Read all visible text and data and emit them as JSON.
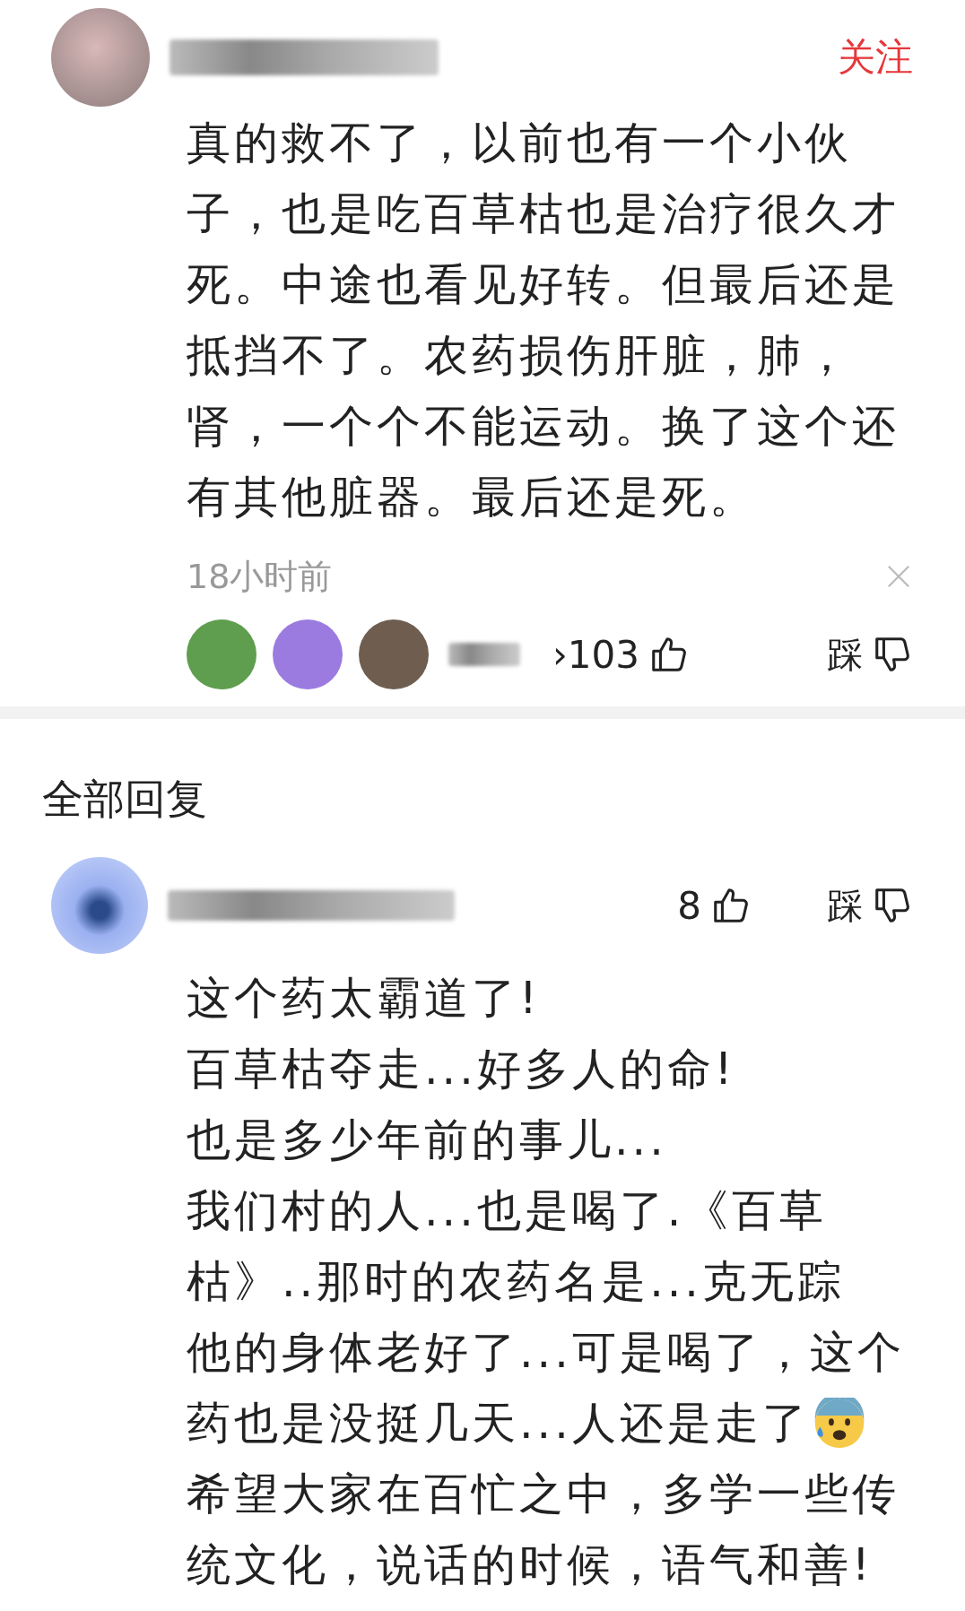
{
  "comment": {
    "follow": "关注",
    "text_lines": [
      {
        "text": "真的救不了，以前也有一个小伙"
      },
      {
        "text": "子，也是吃百草枯也是治疗很久才"
      },
      {
        "text": "死。中途也看见好转。但最后还是"
      },
      {
        "text": "抵挡不了。农药损伤肝脏，肺，"
      },
      {
        "text": "肾，一个个不能运动。换了这个还"
      },
      {
        "text": "有其他脏器。最后还是死。"
      }
    ],
    "time": "18小时前",
    "liker_avatars": [
      {
        "color": "#5f9e4e"
      },
      {
        "color": "#9b7be0"
      },
      {
        "color": "#6f5e50"
      }
    ],
    "like_count": "›103",
    "dislike_label": "踩"
  },
  "replies_header": "全部回复",
  "reply": {
    "like_count": "8",
    "dislike_label": "踩",
    "text_lines": [
      {
        "text": "这个药太霸道了!"
      },
      {
        "text": "百草枯夺走...好多人的命!"
      },
      {
        "text": "也是多少年前的事儿..."
      },
      {
        "text": "我们村的人...也是喝了.《百草"
      },
      {
        "text": "枯》..那时的农药名是...克无踪"
      },
      {
        "text": "他的身体老好了...可是喝了，这个"
      },
      {
        "text": "药也是没挺几天...人还是走了",
        "emoji": true
      },
      {
        "text": "希望大家在百忙之中，多学一些传"
      },
      {
        "text": "统文化，说话的时候，语气和善!"
      }
    ]
  }
}
